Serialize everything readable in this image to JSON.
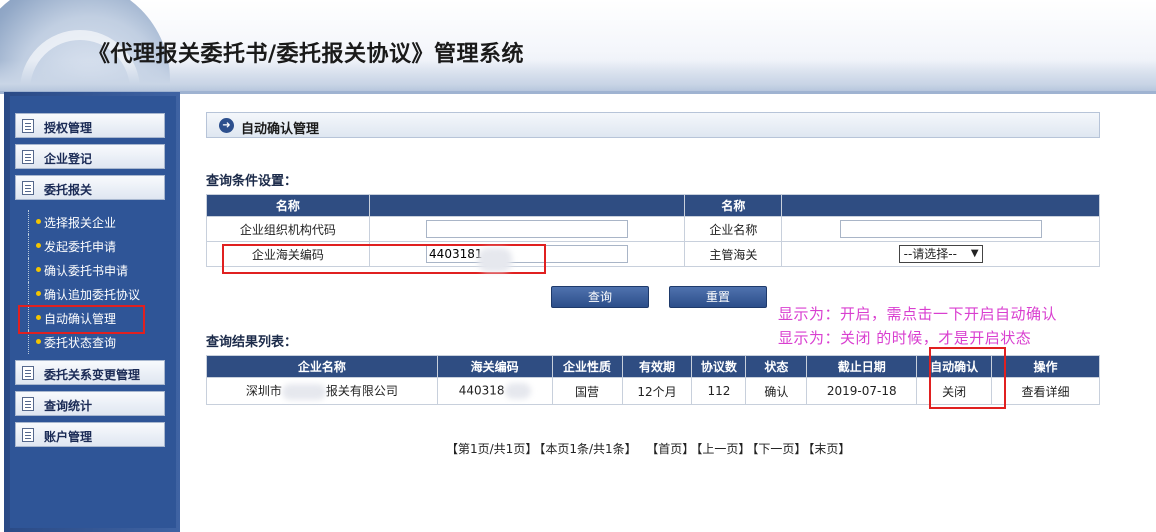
{
  "header": {
    "title": "《代理报关委托书/委托报关协议》管理系统"
  },
  "sidebar": {
    "buttons": [
      {
        "label": "授权管理"
      },
      {
        "label": "企业登记"
      },
      {
        "label": "委托报关"
      },
      {
        "label": "委托关系变更管理"
      },
      {
        "label": "查询统计"
      },
      {
        "label": "账户管理"
      }
    ],
    "sub_items": [
      {
        "label": "选择报关企业"
      },
      {
        "label": "发起委托申请"
      },
      {
        "label": "确认委托书申请"
      },
      {
        "label": "确认追加委托协议"
      },
      {
        "label": "自动确认管理"
      },
      {
        "label": "委托状态查询"
      }
    ]
  },
  "panel": {
    "title": "自动确认管理"
  },
  "query": {
    "section_title": "查询条件设置：",
    "col_name_1": "名称",
    "col_name_2": "名称",
    "row1": {
      "label_left": "企业组织机构代码",
      "value_left": "",
      "label_right": "企业名称",
      "value_right": ""
    },
    "row2": {
      "label_left": "企业海关编码",
      "value_left": "4403181",
      "label_right": "主管海关",
      "select_value": "--请选择--"
    }
  },
  "buttons": {
    "query": "查询",
    "reset": "重置"
  },
  "note": {
    "line1": "显示为：开启，需点击一下开启自动确认",
    "line2": "显示为：关闭 的时候，才是开启状态"
  },
  "results": {
    "section_title": "查询结果列表：",
    "headers": [
      "企业名称",
      "海关编码",
      "企业性质",
      "有效期",
      "协议数",
      "状态",
      "截止日期",
      "自动确认",
      "操作"
    ],
    "rows": [
      {
        "name_prefix": "深圳市",
        "name_suffix": "报关有限公司",
        "code": "440318",
        "nature": "国营",
        "period": "12个月",
        "count": "112",
        "status": "确认",
        "deadline": "2019-07-18",
        "auto": "关闭",
        "action": "查看详细"
      }
    ]
  },
  "pager": {
    "page_info": "【第1页/共1页】",
    "row_info": "【本页1条/共1条】",
    "first": "【首页】",
    "prev": "【上一页】",
    "next": "【下一页】",
    "last": "【末页】"
  },
  "colors": {
    "accent": "#2f4d82",
    "highlight": "#e02020",
    "note": "#d93fd0"
  }
}
